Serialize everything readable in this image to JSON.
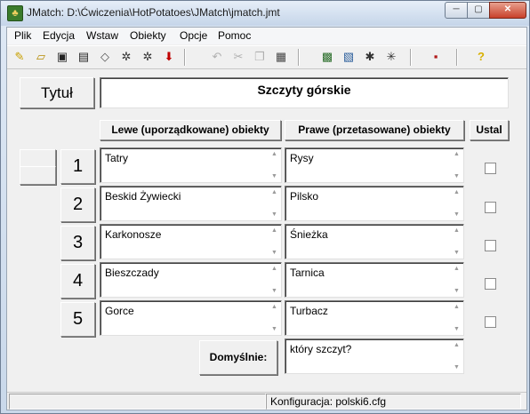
{
  "window": {
    "title": "JMatch: D:\\Ćwiczenia\\HotPotatoes\\JMatch\\jmatch.jmt",
    "min": "─",
    "max": "▢",
    "close": "✕"
  },
  "menu": [
    "Plik",
    "Edycja",
    "Wstaw",
    "Obiekty",
    "Opcje",
    "Pomoc"
  ],
  "toolbar": {
    "icons": [
      "new-file",
      "open",
      "save",
      "save-as",
      "eraser",
      "web-page-1",
      "web-page-2",
      "arrow-down",
      "undo",
      "cut",
      "copy",
      "paste",
      "export-1",
      "export-2",
      "export-3",
      "export-4",
      "monitor",
      "help"
    ]
  },
  "title_button": "Tytuł",
  "title_value": "Szczyty górskie",
  "headers": {
    "left": "Lewe (uporządkowane) obiekty",
    "right": "Prawe (przetasowane) obiekty",
    "fix": "Ustal"
  },
  "rows": [
    {
      "num": "1",
      "left": "Tatry",
      "right": "Rysy",
      "fixed": false
    },
    {
      "num": "2",
      "left": "Beskid Żywiecki",
      "right": "Pilsko",
      "fixed": false
    },
    {
      "num": "3",
      "left": "Karkonosze",
      "right": "Śnieżka",
      "fixed": false
    },
    {
      "num": "4",
      "left": "Bieszczady",
      "right": "Tarnica",
      "fixed": false
    },
    {
      "num": "5",
      "left": "Gorce",
      "right": "Turbacz",
      "fixed": false
    }
  ],
  "default_label": "Domyślnie:",
  "default_value": "który szczyt?",
  "status": {
    "config": "Konfiguracja: polski6.cfg"
  }
}
